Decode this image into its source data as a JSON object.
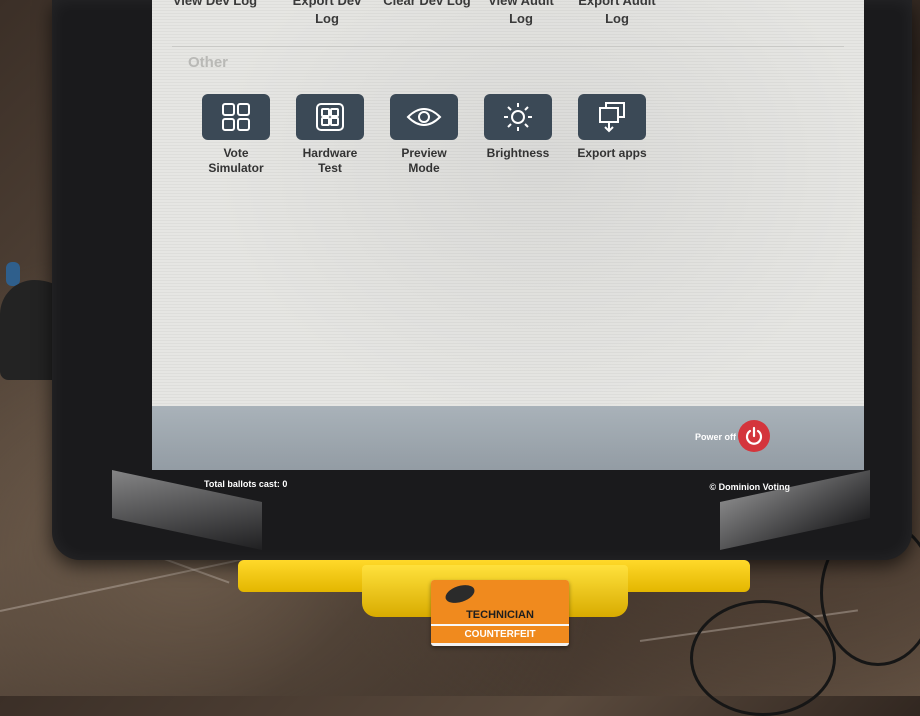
{
  "screen": {
    "top_labels": [
      {
        "text": "View Dev Log"
      },
      {
        "text": "Export Dev\nLog"
      },
      {
        "text": "Clear Dev Log"
      },
      {
        "text": "View Audit\nLog"
      },
      {
        "text": "Export Audit\nLog"
      }
    ],
    "section_other": "Other",
    "tiles": [
      {
        "label": "Vote\nSimulator",
        "icon": "grid-4-icon"
      },
      {
        "label": "Hardware\nTest",
        "icon": "hardware-grid-icon"
      },
      {
        "label": "Preview\nMode",
        "icon": "eye-icon"
      },
      {
        "label": "Brightness",
        "icon": "sun-icon"
      },
      {
        "label": "Export apps",
        "icon": "export-windows-icon"
      }
    ],
    "power_off_label": "Power off",
    "total_ballots": "Total ballots cast: 0",
    "copyright": "© Dominion Voting"
  },
  "card": {
    "title": "TECHNICIAN",
    "subtitle": "COUNTERFEIT"
  },
  "colors": {
    "tile_bg": "#3b4956",
    "power_red": "#d4353c",
    "stand_yellow": "#ffd92a",
    "card_orange": "#f08a1e"
  }
}
